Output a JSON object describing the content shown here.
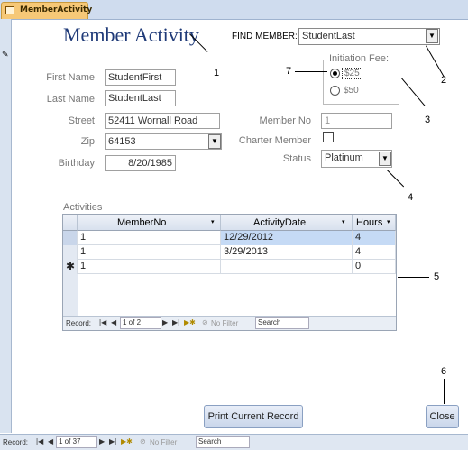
{
  "tab": {
    "label": "MemberActivity"
  },
  "form": {
    "title": "Member Activity",
    "find_member_label": "FIND MEMBER:",
    "find_member_value": "StudentLast",
    "first_name_label": "First Name",
    "first_name_value": "StudentFirst",
    "last_name_label": "Last Name",
    "last_name_value": "StudentLast",
    "street_label": "Street",
    "street_value": "52411 Wornall Road",
    "zip_label": "Zip",
    "zip_value": "64153",
    "birthday_label": "Birthday",
    "birthday_value": "8/20/1985",
    "initiation_fee_label": "Initiation Fee:",
    "fee_options": [
      "$25",
      "$50"
    ],
    "member_no_label": "Member No",
    "member_no_value": "1",
    "charter_member_label": "Charter Member",
    "status_label": "Status",
    "status_value": "Platinum"
  },
  "callouts": [
    "1",
    "2",
    "3",
    "4",
    "5",
    "6",
    "7"
  ],
  "activities": {
    "label": "Activities",
    "headers": [
      "MemberNo",
      "ActivityDate",
      "Hours"
    ],
    "rows": [
      [
        "1",
        "12/29/2012",
        "4"
      ],
      [
        "1",
        "3/29/2013",
        "4"
      ]
    ],
    "new_row": [
      "1",
      "",
      "0"
    ],
    "nav_record_label": "Record:",
    "nav_position": "1 of 2",
    "nav_filter": "No Filter",
    "nav_search": "Search"
  },
  "buttons": {
    "print": "Print Current Record",
    "close": "Close"
  },
  "statusbar": {
    "record_label": "Record:",
    "position": "1 of 37",
    "filter": "No Filter",
    "search": "Search"
  },
  "colors": {
    "title": "#1f3a78",
    "tab": "#f6c877",
    "selected_cell": "#c5daf5"
  },
  "icons": [
    "form-icon",
    "pencil-icon",
    "dropdown-arrow-icon",
    "sort-arrow-icon",
    "nav-first-icon",
    "nav-prev-icon",
    "nav-next-icon",
    "nav-last-icon",
    "nav-new-icon",
    "filter-icon"
  ]
}
